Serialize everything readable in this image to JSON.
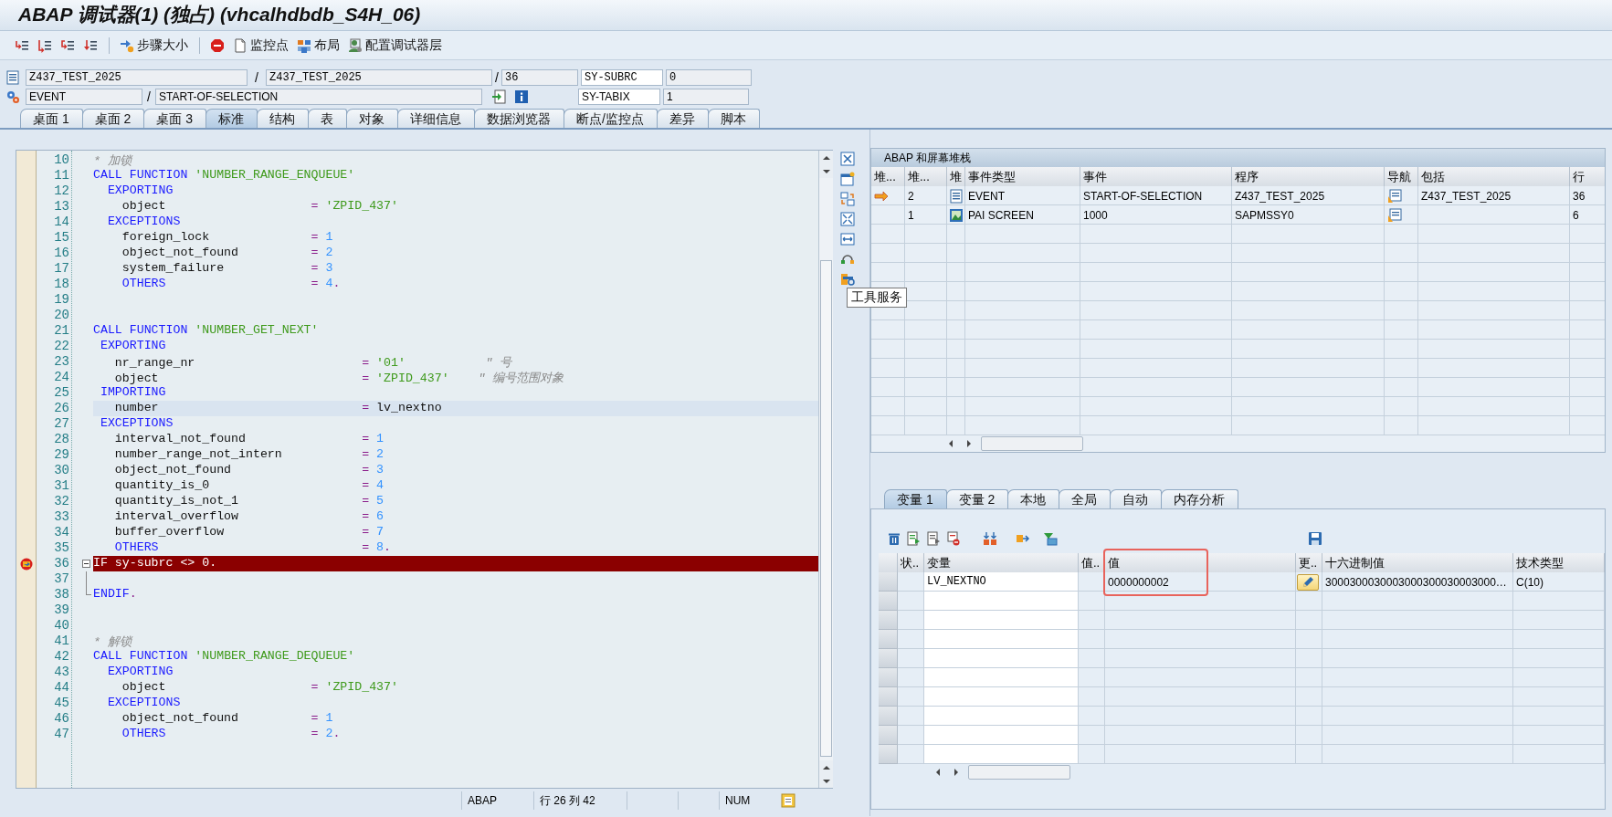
{
  "window": {
    "title": "ABAP 调试器(1) (独占) (vhcalhdbdb_S4H_06)"
  },
  "toolbar": [
    {
      "kind": "button"
    },
    {
      "kind": "button"
    },
    {
      "kind": "button"
    },
    {
      "kind": "button"
    },
    {
      "kind": "separator"
    },
    {
      "kind": "button",
      "label": "步骤大小"
    },
    {
      "kind": "separator"
    },
    {
      "kind": "button"
    },
    {
      "kind": "button",
      "label": "监控点"
    },
    {
      "kind": "button",
      "label": "布局"
    },
    {
      "kind": "button",
      "label": "配置调试器层"
    }
  ],
  "info_rows": [
    {
      "items": [
        {
          "kind": "field",
          "value": "Z437_TEST_2025"
        },
        {
          "kind": "slash",
          "text": "/"
        },
        {
          "kind": "field",
          "value": "Z437_TEST_2025"
        },
        {
          "kind": "slash",
          "text": "/"
        },
        {
          "kind": "field",
          "value": "36"
        },
        {
          "kind": "label",
          "text": "SY-SUBRC"
        },
        {
          "kind": "field",
          "value": "0"
        }
      ]
    },
    {
      "items": [
        {
          "kind": "field",
          "value": "EVENT"
        },
        {
          "kind": "slash",
          "text": "/"
        },
        {
          "kind": "field",
          "value": "START-OF-SELECTION"
        },
        {
          "kind": "icon"
        },
        {
          "kind": "icon"
        },
        {
          "kind": "label",
          "text": "SY-TABIX"
        },
        {
          "kind": "field",
          "value": "1"
        }
      ]
    }
  ],
  "tabs": [
    {
      "label": "桌面 1",
      "selected": false
    },
    {
      "label": "桌面 2",
      "selected": false
    },
    {
      "label": "桌面 3",
      "selected": false
    },
    {
      "label": "标准",
      "selected": true
    },
    {
      "label": "结构",
      "selected": false
    },
    {
      "label": "表",
      "selected": false
    },
    {
      "label": "对象",
      "selected": false
    },
    {
      "label": "详细信息",
      "selected": false
    },
    {
      "label": "数据浏览器",
      "selected": false
    },
    {
      "label": "断点/监控点",
      "selected": false
    },
    {
      "label": "差异",
      "selected": false
    },
    {
      "label": "脚本",
      "selected": false
    }
  ],
  "editor": {
    "lines": [
      {
        "number": "10",
        "kind": "code",
        "current": false,
        "cursor": false,
        "tokens": [
          {
            "kind": "comment",
            "text": "* 加锁"
          }
        ]
      },
      {
        "number": "11",
        "kind": "code",
        "current": false,
        "cursor": false,
        "tokens": [
          {
            "kind": "keyword",
            "text": "CALL FUNCTION "
          },
          {
            "kind": "string",
            "text": "'NUMBER_RANGE_ENQUEUE'"
          }
        ]
      },
      {
        "number": "12",
        "kind": "code",
        "current": false,
        "cursor": false,
        "tokens": [
          {
            "kind": "keyword",
            "text": "  EXPORTING"
          }
        ]
      },
      {
        "number": "13",
        "kind": "code",
        "current": false,
        "cursor": false,
        "tokens": [
          {
            "kind": "plain",
            "text": "    object                    "
          },
          {
            "kind": "operator",
            "text": "="
          },
          {
            "kind": "string",
            "text": " 'ZPID_437'"
          }
        ]
      },
      {
        "number": "14",
        "kind": "code",
        "current": false,
        "cursor": false,
        "tokens": [
          {
            "kind": "keyword",
            "text": "  EXCEPTIONS"
          }
        ]
      },
      {
        "number": "15",
        "kind": "code",
        "current": false,
        "cursor": false,
        "tokens": [
          {
            "kind": "plain",
            "text": "    foreign_lock              "
          },
          {
            "kind": "operator",
            "text": "="
          },
          {
            "kind": "number",
            "text": " 1"
          }
        ]
      },
      {
        "number": "16",
        "kind": "code",
        "current": false,
        "cursor": false,
        "tokens": [
          {
            "kind": "plain",
            "text": "    object_not_found          "
          },
          {
            "kind": "operator",
            "text": "="
          },
          {
            "kind": "number",
            "text": " 2"
          }
        ]
      },
      {
        "number": "17",
        "kind": "code",
        "current": false,
        "cursor": false,
        "tokens": [
          {
            "kind": "plain",
            "text": "    system_failure            "
          },
          {
            "kind": "operator",
            "text": "="
          },
          {
            "kind": "number",
            "text": " 3"
          }
        ]
      },
      {
        "number": "18",
        "kind": "code",
        "current": false,
        "cursor": false,
        "tokens": [
          {
            "kind": "keyword",
            "text": "    OTHERS                    "
          },
          {
            "kind": "operator",
            "text": "="
          },
          {
            "kind": "number",
            "text": " 4"
          },
          {
            "kind": "operator",
            "text": "."
          }
        ]
      },
      {
        "number": "19",
        "kind": "code",
        "current": false,
        "cursor": false
      },
      {
        "number": "20",
        "kind": "code",
        "current": false,
        "cursor": false
      },
      {
        "number": "21",
        "kind": "code",
        "current": false,
        "cursor": false,
        "tokens": [
          {
            "kind": "keyword",
            "text": "CALL FUNCTION "
          },
          {
            "kind": "string",
            "text": "'NUMBER_GET_NEXT'"
          }
        ]
      },
      {
        "number": "22",
        "kind": "code",
        "current": false,
        "cursor": false,
        "tokens": [
          {
            "kind": "keyword",
            "text": " EXPORTING"
          }
        ]
      },
      {
        "number": "23",
        "kind": "code",
        "current": false,
        "cursor": false,
        "tokens": [
          {
            "kind": "plain",
            "text": "   nr_range_nr                       "
          },
          {
            "kind": "operator",
            "text": "="
          },
          {
            "kind": "string",
            "text": " '01'"
          },
          {
            "kind": "comment",
            "text": "           \" 号"
          }
        ]
      },
      {
        "number": "24",
        "kind": "code",
        "current": false,
        "cursor": false,
        "tokens": [
          {
            "kind": "plain",
            "text": "   object                            "
          },
          {
            "kind": "operator",
            "text": "="
          },
          {
            "kind": "string",
            "text": " 'ZPID_437'"
          },
          {
            "kind": "comment",
            "text": "    \" 编号范围对象"
          }
        ]
      },
      {
        "number": "25",
        "kind": "code",
        "current": false,
        "cursor": false,
        "tokens": [
          {
            "kind": "keyword",
            "text": " IMPORTING"
          }
        ]
      },
      {
        "number": "26",
        "kind": "code",
        "current": false,
        "cursor": true,
        "tokens": [
          {
            "kind": "plain",
            "text": "   number                            "
          },
          {
            "kind": "operator",
            "text": "="
          },
          {
            "kind": "plain",
            "text": " lv_nextno"
          }
        ]
      },
      {
        "number": "27",
        "kind": "code",
        "current": false,
        "cursor": false,
        "tokens": [
          {
            "kind": "keyword",
            "text": " EXCEPTIONS"
          }
        ]
      },
      {
        "number": "28",
        "kind": "code",
        "current": false,
        "cursor": false,
        "tokens": [
          {
            "kind": "plain",
            "text": "   interval_not_found                "
          },
          {
            "kind": "operator",
            "text": "="
          },
          {
            "kind": "number",
            "text": " 1"
          }
        ]
      },
      {
        "number": "29",
        "kind": "code",
        "current": false,
        "cursor": false,
        "tokens": [
          {
            "kind": "plain",
            "text": "   number_range_not_intern           "
          },
          {
            "kind": "operator",
            "text": "="
          },
          {
            "kind": "number",
            "text": " 2"
          }
        ]
      },
      {
        "number": "30",
        "kind": "code",
        "current": false,
        "cursor": false,
        "tokens": [
          {
            "kind": "plain",
            "text": "   object_not_found                  "
          },
          {
            "kind": "operator",
            "text": "="
          },
          {
            "kind": "number",
            "text": " 3"
          }
        ]
      },
      {
        "number": "31",
        "kind": "code",
        "current": false,
        "cursor": false,
        "tokens": [
          {
            "kind": "plain",
            "text": "   quantity_is_0                     "
          },
          {
            "kind": "operator",
            "text": "="
          },
          {
            "kind": "number",
            "text": " 4"
          }
        ]
      },
      {
        "number": "32",
        "kind": "code",
        "current": false,
        "cursor": false,
        "tokens": [
          {
            "kind": "plain",
            "text": "   quantity_is_not_1                 "
          },
          {
            "kind": "operator",
            "text": "="
          },
          {
            "kind": "number",
            "text": " 5"
          }
        ]
      },
      {
        "number": "33",
        "kind": "code",
        "current": false,
        "cursor": false,
        "tokens": [
          {
            "kind": "plain",
            "text": "   interval_overflow                 "
          },
          {
            "kind": "operator",
            "text": "="
          },
          {
            "kind": "number",
            "text": " 6"
          }
        ]
      },
      {
        "number": "34",
        "kind": "code",
        "current": false,
        "cursor": false,
        "tokens": [
          {
            "kind": "plain",
            "text": "   buffer_overflow                   "
          },
          {
            "kind": "operator",
            "text": "="
          },
          {
            "kind": "number",
            "text": " 7"
          }
        ]
      },
      {
        "number": "35",
        "kind": "code",
        "current": false,
        "cursor": false,
        "tokens": [
          {
            "kind": "keyword",
            "text": "   OTHERS                            "
          },
          {
            "kind": "operator",
            "text": "="
          },
          {
            "kind": "number",
            "text": " 8"
          },
          {
            "kind": "operator",
            "text": "."
          }
        ]
      },
      {
        "number": "36",
        "kind": "block-start",
        "current": true,
        "cursor": false,
        "tokens": [
          {
            "kind": "keyword",
            "text": "IF "
          },
          {
            "kind": "plain",
            "text": "sy-subrc "
          },
          {
            "kind": "operator",
            "text": "<>"
          },
          {
            "kind": "number",
            "text": " 0"
          },
          {
            "kind": "operator",
            "text": "."
          }
        ]
      },
      {
        "number": "37",
        "kind": "block-body",
        "current": false,
        "cursor": false
      },
      {
        "number": "38",
        "kind": "block-end",
        "current": false,
        "cursor": false,
        "tokens": [
          {
            "kind": "keyword",
            "text": "ENDIF"
          },
          {
            "kind": "operator",
            "text": "."
          }
        ]
      },
      {
        "number": "39",
        "kind": "code",
        "current": false,
        "cursor": false
      },
      {
        "number": "40",
        "kind": "code",
        "current": false,
        "cursor": false
      },
      {
        "number": "41",
        "kind": "code",
        "current": false,
        "cursor": false,
        "tokens": [
          {
            "kind": "comment",
            "text": "* 解锁"
          }
        ]
      },
      {
        "number": "42",
        "kind": "code",
        "current": false,
        "cursor": false,
        "tokens": [
          {
            "kind": "keyword",
            "text": "CALL FUNCTION "
          },
          {
            "kind": "string",
            "text": "'NUMBER_RANGE_DEQUEUE'"
          }
        ]
      },
      {
        "number": "43",
        "kind": "code",
        "current": false,
        "cursor": false,
        "tokens": [
          {
            "kind": "keyword",
            "text": "  EXPORTING"
          }
        ]
      },
      {
        "number": "44",
        "kind": "code",
        "current": false,
        "cursor": false,
        "tokens": [
          {
            "kind": "plain",
            "text": "    object                    "
          },
          {
            "kind": "operator",
            "text": "="
          },
          {
            "kind": "string",
            "text": " 'ZPID_437'"
          }
        ]
      },
      {
        "number": "45",
        "kind": "code",
        "current": false,
        "cursor": false,
        "tokens": [
          {
            "kind": "keyword",
            "text": "  EXCEPTIONS"
          }
        ]
      },
      {
        "number": "46",
        "kind": "code",
        "current": false,
        "cursor": false,
        "tokens": [
          {
            "kind": "plain",
            "text": "    object_not_found          "
          },
          {
            "kind": "operator",
            "text": "="
          },
          {
            "kind": "number",
            "text": " 1"
          }
        ]
      },
      {
        "number": "47",
        "kind": "code",
        "current": false,
        "cursor": false,
        "tokens": [
          {
            "kind": "keyword",
            "text": "    OTHERS                    "
          },
          {
            "kind": "operator",
            "text": "="
          },
          {
            "kind": "number",
            "text": " 2"
          },
          {
            "kind": "operator",
            "text": "."
          }
        ]
      }
    ],
    "status": {
      "language": "ABAP",
      "position": "行 26 列 42",
      "mode": "NUM"
    }
  },
  "tooltip": "工具服务",
  "stack": {
    "title": "ABAP 和屏幕堆栈",
    "columns": [
      "堆...",
      "堆...",
      "堆",
      "事件类型",
      "事件",
      "程序",
      "导航",
      "包括",
      "行"
    ],
    "rows": [
      {
        "active": true,
        "stack_no": "2",
        "kind": "event",
        "event_type": "EVENT",
        "event": "START-OF-SELECTION",
        "program": "Z437_TEST_2025",
        "include": "Z437_TEST_2025",
        "line": "36"
      },
      {
        "active": false,
        "stack_no": "1",
        "kind": "screen",
        "event_type": "PAI SCREEN",
        "event": "1000",
        "program": "SAPMSSY0",
        "line": "6"
      }
    ]
  },
  "variables": {
    "tabs": [
      {
        "label": "变量 1",
        "selected": true
      },
      {
        "label": "变量 2",
        "selected": false
      },
      {
        "label": "本地",
        "selected": false
      },
      {
        "label": "全局",
        "selected": false
      },
      {
        "label": "自动",
        "selected": false
      },
      {
        "label": "内存分析",
        "selected": false
      }
    ],
    "columns": [
      {
        "label": "状..",
        "highlighted": false
      },
      {
        "label": "变量",
        "highlighted": false
      },
      {
        "label": "值..",
        "highlighted": false
      },
      {
        "label": "值",
        "highlighted": true
      },
      {
        "label": "更..",
        "highlighted": false
      },
      {
        "label": "十六进制值",
        "highlighted": false
      },
      {
        "label": "技术类型",
        "highlighted": false
      }
    ],
    "rows": [
      {
        "variable": "LV_NEXTNO",
        "value": "0000000002",
        "editable": true,
        "hex": "3000300030003000300030003000…",
        "type": "C(10)"
      }
    ]
  }
}
